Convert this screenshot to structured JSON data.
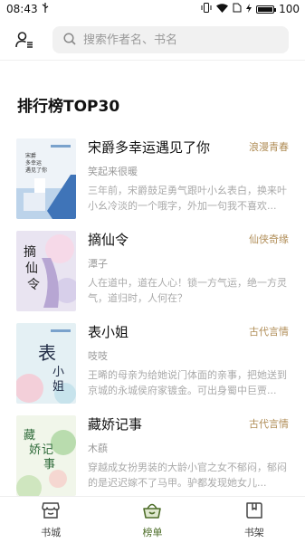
{
  "status_bar": {
    "time": "08:43",
    "battery": "100",
    "battery_level": 1.0
  },
  "search": {
    "placeholder": "搜索作者名、书名"
  },
  "page_title": "排行榜TOP30",
  "books": [
    {
      "title": "宋爵多幸运遇见了你",
      "tag": "浪漫青春",
      "author": "笑起来很暖",
      "desc": "三年前，宋爵鼓足勇气跟叶小幺表白，换来叶小幺冷淡的一个哦字，外加一句我不喜欢...",
      "cover_lines": [
        "宋爵",
        "多幸运",
        "遇见了你"
      ]
    },
    {
      "title": "摘仙令",
      "tag": "仙侠奇缘",
      "author": "潭子",
      "desc": "人在道中，道在人心！锁一方气运，绝一方灵气，道归时，人何在？",
      "cover_lines": [
        "摘",
        "仙",
        "令"
      ]
    },
    {
      "title": "表小姐",
      "tag": "古代言情",
      "author": "吱吱",
      "desc": "王晞的母亲为给她说门体面的亲事，把她送到京城的永城侯府家镀金。可出身蜀中巨贾...",
      "cover_lines": [
        "表",
        "小",
        "姐"
      ]
    },
    {
      "title": "藏娇记事",
      "tag": "古代言情",
      "author": "木蕻",
      "desc": "穿越成女扮男装的大龄小官之女不郁闷，郁闷的是迟迟嫁不了马甲。驴都发现她女儿...",
      "cover_lines": [
        "藏",
        "娇",
        "记",
        "事"
      ]
    }
  ],
  "bottom_nav": [
    {
      "label": "书城",
      "icon": "store-icon"
    },
    {
      "label": "榜单",
      "icon": "ranking-basket-icon"
    },
    {
      "label": "书架",
      "icon": "bookshelf-icon"
    }
  ],
  "colors": {
    "accent": "#4e6e2a",
    "tag": "#b08d57",
    "muted": "#aaaaaa"
  }
}
